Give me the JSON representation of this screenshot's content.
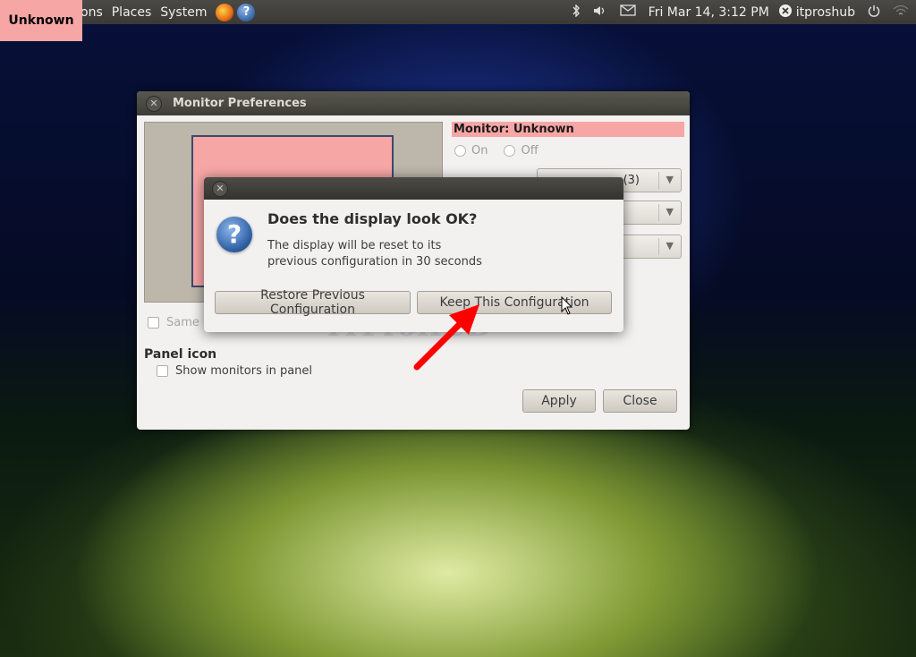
{
  "top_panel": {
    "menus": [
      "ons",
      "Places",
      "System"
    ],
    "datetime": "Fri Mar 14,  3:12 PM",
    "user": "itproshub"
  },
  "overlay_label": "Unknown",
  "main_window": {
    "title": "Monitor Preferences",
    "monitor_label": "Monitor: Unknown",
    "radio_on": "On",
    "radio_off": "Off",
    "combo_visible_value": "(3)",
    "same_image_label": "Same i",
    "panel_icon_title": "Panel icon",
    "show_monitors_label": "Show monitors in panel",
    "apply_label": "Apply",
    "close_label": "Close",
    "watermark": "ITProHUB"
  },
  "dialog": {
    "title": "Does the display look OK?",
    "message_line1": "The display will be reset to its",
    "message_line2": "previous configuration in 30 seconds",
    "restore_label": "Restore Previous Configuration",
    "keep_label": "Keep This Configuration",
    "icon_glyph": "?"
  },
  "colors": {
    "highlight_pink": "#f7a6a6",
    "arrow_red": "#ff0000"
  }
}
